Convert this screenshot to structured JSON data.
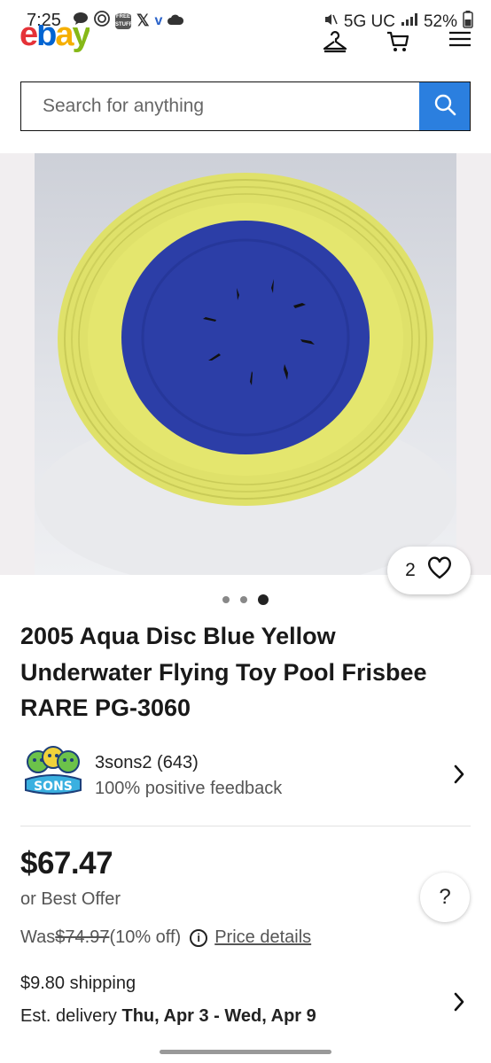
{
  "status_bar": {
    "time": "7:25",
    "network": "5G UC",
    "battery": "52%"
  },
  "header": {
    "logo_letters": [
      "e",
      "b",
      "a",
      "y"
    ]
  },
  "search": {
    "placeholder": "Search for anything"
  },
  "gallery": {
    "watch_count": "2",
    "dots": 3,
    "active_dot": 3
  },
  "listing": {
    "title": "2005 Aqua Disc Blue Yellow Underwater Flying Toy Pool Frisbee RARE PG-3060"
  },
  "seller": {
    "name": "3sons2 (643)",
    "feedback": "100% positive feedback"
  },
  "price": {
    "amount": "$67.47",
    "best_offer": "or Best Offer",
    "was_label": "Was ",
    "was_price": "$74.97",
    "discount": " (10% off)",
    "details_link": "Price details"
  },
  "shipping": {
    "cost": "$9.80 shipping",
    "delivery_label": "Est. delivery ",
    "delivery_dates": "Thu, Apr 3 - Wed, Apr 9"
  },
  "help_label": "?",
  "colors": {
    "search_button": "#2b7fdf",
    "frisbee_rim": "#e6e86a",
    "frisbee_center": "#2b3ea6"
  }
}
